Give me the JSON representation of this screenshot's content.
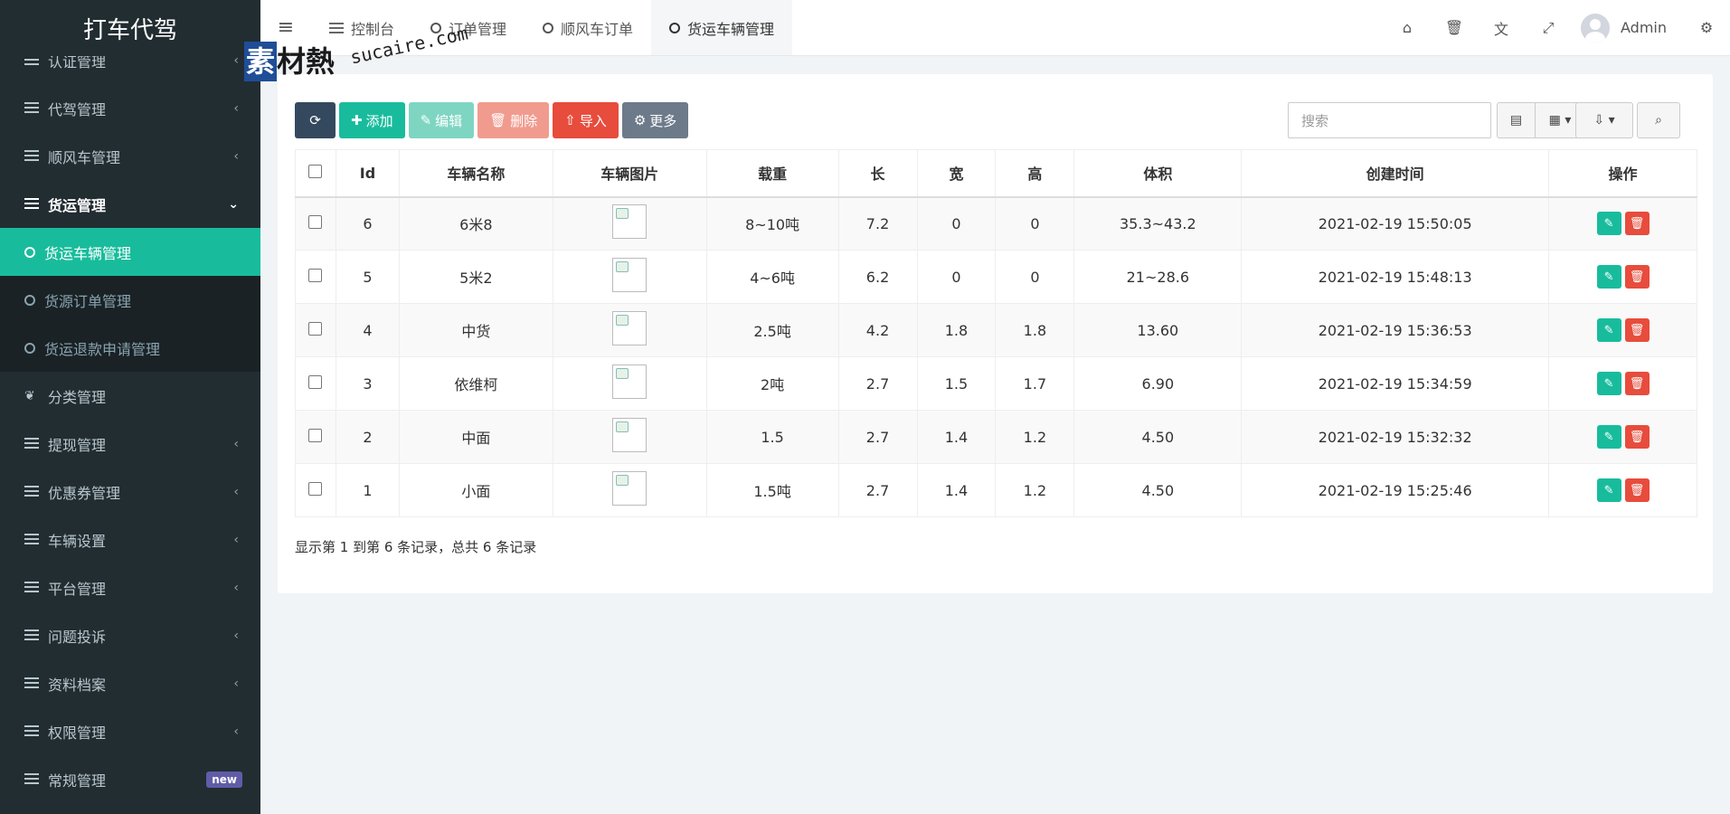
{
  "app": {
    "title": "打车代驾"
  },
  "watermark": {
    "mark": "素",
    "text": "材熱",
    "url": "sucaire.com"
  },
  "sidebar": {
    "items": [
      {
        "label": "认证管理",
        "name": "sidebar-item-auth"
      },
      {
        "label": "代驾管理",
        "name": "sidebar-item-driving"
      },
      {
        "label": "顺风车管理",
        "name": "sidebar-item-carpool"
      },
      {
        "label": "货运管理",
        "name": "sidebar-item-freight"
      }
    ],
    "sub_items": [
      {
        "label": "货运车辆管理"
      },
      {
        "label": "货源订单管理"
      },
      {
        "label": "货运退款申请管理"
      }
    ],
    "items_after": [
      {
        "label": "分类管理"
      },
      {
        "label": "提现管理"
      },
      {
        "label": "优惠券管理"
      },
      {
        "label": "车辆设置"
      },
      {
        "label": "平台管理"
      },
      {
        "label": "问题投诉"
      },
      {
        "label": "资料档案"
      },
      {
        "label": "权限管理"
      },
      {
        "label": "常规管理"
      }
    ],
    "new_badge": "new"
  },
  "tabs": [
    {
      "label": "控制台"
    },
    {
      "label": "订单管理"
    },
    {
      "label": "顺风车订单"
    },
    {
      "label": "货运车辆管理"
    }
  ],
  "user": {
    "name": "Admin"
  },
  "toolbar": {
    "add": "添加",
    "edit": "编辑",
    "delete": "删除",
    "import": "导入",
    "more": "更多",
    "search_placeholder": "搜索"
  },
  "table": {
    "headers": [
      "Id",
      "车辆名称",
      "车辆图片",
      "载重",
      "长",
      "宽",
      "高",
      "体积",
      "创建时间",
      "操作"
    ],
    "rows": [
      {
        "id": "6",
        "name": "6米8",
        "load": "8~10吨",
        "length": "7.2",
        "width": "0",
        "height": "0",
        "volume": "35.3~43.2",
        "created": "2021-02-19 15:50:05"
      },
      {
        "id": "5",
        "name": "5米2",
        "load": "4~6吨",
        "length": "6.2",
        "width": "0",
        "height": "0",
        "volume": "21~28.6",
        "created": "2021-02-19 15:48:13"
      },
      {
        "id": "4",
        "name": "中货",
        "load": "2.5吨",
        "length": "4.2",
        "width": "1.8",
        "height": "1.8",
        "volume": "13.60",
        "created": "2021-02-19 15:36:53"
      },
      {
        "id": "3",
        "name": "依维柯",
        "load": "2吨",
        "length": "2.7",
        "width": "1.5",
        "height": "1.7",
        "volume": "6.90",
        "created": "2021-02-19 15:34:59"
      },
      {
        "id": "2",
        "name": "中面",
        "load": "1.5",
        "length": "2.7",
        "width": "1.4",
        "height": "1.2",
        "volume": "4.50",
        "created": "2021-02-19 15:32:32"
      },
      {
        "id": "1",
        "name": "小面",
        "load": "1.5吨",
        "length": "2.7",
        "width": "1.4",
        "height": "1.2",
        "volume": "4.50",
        "created": "2021-02-19 15:25:46"
      }
    ]
  },
  "pagination": {
    "summary": "显示第 1 到第 6 条记录，总共 6 条记录"
  },
  "colors": {
    "sidebar_bg": "#222d32",
    "accent": "#18bc9c",
    "danger": "#e74c3c",
    "dark_button": "#34495e"
  }
}
